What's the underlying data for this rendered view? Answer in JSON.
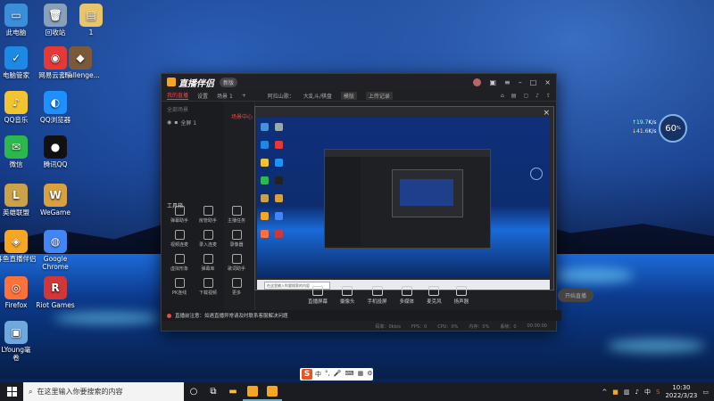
{
  "desktop": {
    "icons": [
      {
        "label": "此电脑",
        "glyph": "▭",
        "color": "#3b8fd9"
      },
      {
        "label": "回收站",
        "glyph": "🗑",
        "color": "#8aa0b8"
      },
      {
        "label": "1",
        "glyph": "▤",
        "color": "#e9c46a"
      },
      {
        "label": "电脑管家",
        "glyph": "✓",
        "color": "#1e88e5"
      },
      {
        "label": "网易云音乐",
        "glyph": "◉",
        "color": "#e53935"
      },
      {
        "label": "challenge...",
        "glyph": "◆",
        "color": "#7a5a3a"
      },
      {
        "label": "QQ音乐",
        "glyph": "♪",
        "color": "#f4c430"
      },
      {
        "label": "QQ浏览器",
        "glyph": "◐",
        "color": "#1e90ff"
      },
      {
        "label": "微信",
        "glyph": "✉",
        "color": "#2db84d"
      },
      {
        "label": "腾讯QQ",
        "glyph": "●",
        "color": "#111111"
      },
      {
        "label": "英雄联盟",
        "glyph": "L",
        "color": "#c9a24a"
      },
      {
        "label": "WeGame",
        "glyph": "W",
        "color": "#d9a040"
      },
      {
        "label": "斗鱼直播伴侣",
        "glyph": "◈",
        "color": "#f5a623"
      },
      {
        "label": "Google\nChrome",
        "glyph": "◍",
        "color": "#4285f4"
      },
      {
        "label": "Firefox",
        "glyph": "◎",
        "color": "#ff7139"
      },
      {
        "label": "Riot Games",
        "glyph": "R",
        "color": "#d13639"
      },
      {
        "label": "LYoung毫\n卷",
        "glyph": "▣",
        "color": "#6fa8dc"
      }
    ]
  },
  "app": {
    "title": "直播伴侣",
    "version": "新版",
    "tabs": [
      "我的直播",
      "设置",
      "场景 1"
    ],
    "toolbar_text": [
      "阿拉山歌：",
      "大乱斗/棋盘",
      "模版",
      "上传记录"
    ],
    "left_panel": {
      "header": "全部场景",
      "scene": "全屏 1",
      "tools_label": "工具箱"
    },
    "mid_label": "场景中心",
    "tools": [
      "弹幕助手",
      "房管助手",
      "主播任务",
      "视频连麦",
      "录入连麦",
      "录像器",
      "虚拟形象",
      "弹幕库",
      "歌词助手",
      "PK连线",
      "下载视频",
      "更多"
    ],
    "bottom_items": [
      "直播屏幕",
      "摄像头",
      "手机投屏",
      "多媒体",
      "麦克风",
      "扬声器"
    ],
    "start_button": "开始直播",
    "notice": "直播前注意：如遇直播异常请及时联系客服解决问题",
    "status": [
      "码率：0kb/s",
      "FPS：0",
      "CPU：0%",
      "内存：0%",
      "丢帧：0",
      "00:00:00"
    ]
  },
  "preview": {
    "close": "×",
    "search_placeholder": "在这里输入你要搜索的内容"
  },
  "gauge": {
    "value": "60",
    "unit": "%",
    "up": "↑19.7",
    "up_unit": "K/s",
    "down": "↓41.6",
    "down_unit": "K/s"
  },
  "ime": {
    "logo": "S",
    "items": [
      "中",
      "°,",
      "🎤",
      "⌨",
      "▦",
      "⚙"
    ]
  },
  "taskbar": {
    "search_placeholder": "在这里输入你要搜索的内容",
    "time": "10:30",
    "date": "2022/3/23",
    "tray_lang": "中"
  }
}
